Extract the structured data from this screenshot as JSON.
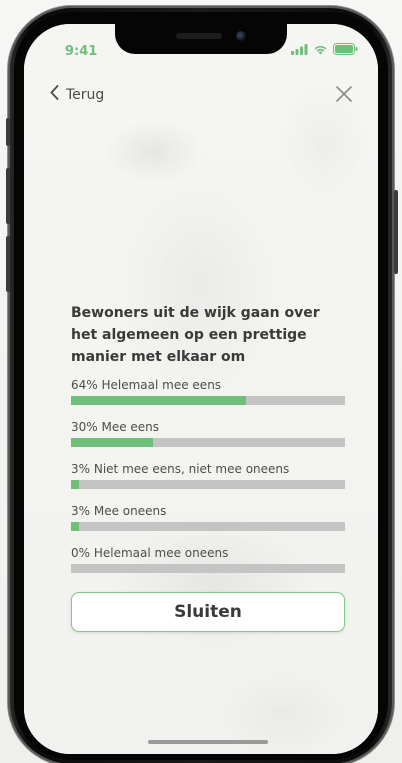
{
  "status_bar": {
    "time": "9:41"
  },
  "nav": {
    "back_label": "Terug",
    "back_icon": "chevron-left-icon",
    "close_icon": "close-icon"
  },
  "poll": {
    "question": "Bewoners uit de wijk gaan over het algemeen op een prettige manier met elkaar om",
    "options": [
      {
        "label": "64% Helemaal mee eens",
        "percent": 64
      },
      {
        "label": "30% Mee eens",
        "percent": 30
      },
      {
        "label": "3% Niet mee eens, niet mee oneens",
        "percent": 3
      },
      {
        "label": "3% Mee oneens",
        "percent": 3
      },
      {
        "label": "0% Helemaal mee oneens",
        "percent": 0
      }
    ]
  },
  "actions": {
    "close_label": "Sluiten"
  },
  "colors": {
    "accent": "#6fbf7a",
    "track": "#c4c4c4",
    "text": "#3a3a3a"
  }
}
